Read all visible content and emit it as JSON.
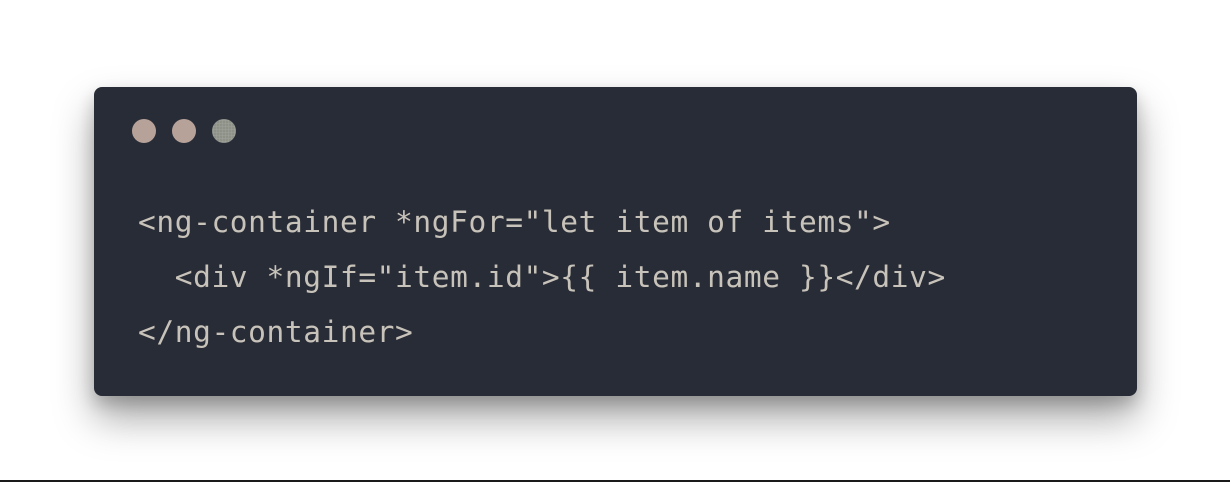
{
  "window": {
    "controls": [
      {
        "name": "close",
        "color": "#b7a29a"
      },
      {
        "name": "minimize",
        "color": "#b7a29a"
      },
      {
        "name": "maximize",
        "color": "#8a8d84"
      }
    ],
    "background": "#282c36",
    "text_color": "#c8c3ba"
  },
  "code": {
    "lines": [
      "<ng-container *ngFor=\"let item of items\">",
      "  <div *ngIf=\"item.id\">{{ item.name }}</div>",
      "</ng-container>"
    ]
  }
}
